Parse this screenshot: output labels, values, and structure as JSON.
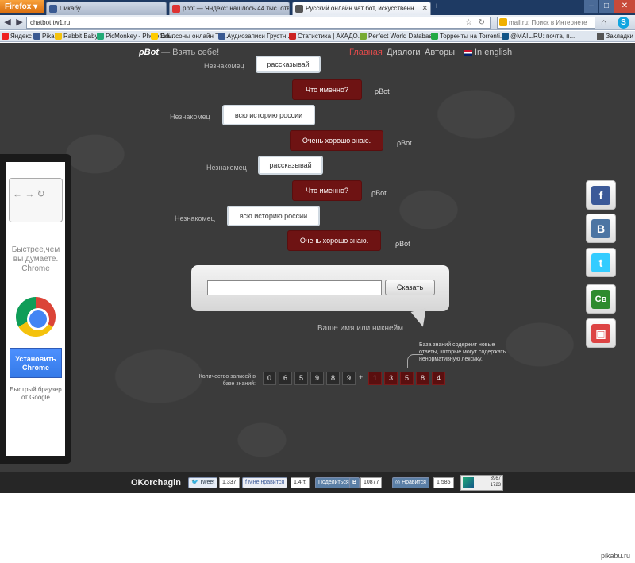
{
  "browser": {
    "menu_label": "Firefox",
    "tabs": [
      {
        "label": "Пикабу",
        "fav": "#3a5a92"
      },
      {
        "label": "pbot — Яндекс: нашлось 44 тыс. отве...",
        "fav": "#d33"
      },
      {
        "label": "Русский онлайн чат бот, искусственн...",
        "fav": "#555"
      }
    ],
    "url": "chatbot.tw1.ru",
    "search_placeholder": "mail.ru: Поиск в Интернете"
  },
  "bookmarks": [
    {
      "label": "Яндекс",
      "color": "#e22"
    },
    {
      "label": "Pikabu",
      "color": "#3a5a92"
    },
    {
      "label": "Rabbit Baby",
      "color": "#f4c20d"
    },
    {
      "label": "PicMonkey - Photo Edi...",
      "color": "#2a7"
    },
    {
      "label": "Симпсоны онлайн Th...",
      "color": "#fc0"
    },
    {
      "label": "Аудиозаписи Грустн...",
      "color": "#3a5a92"
    },
    {
      "label": "Статистика | АКАДО...",
      "color": "#c22"
    },
    {
      "label": "Perfect World Database",
      "color": "#7a3"
    },
    {
      "label": "Торренты на Torrenti...",
      "color": "#2a4"
    },
    {
      "label": "@MAIL.RU: почта, п...",
      "color": "#158"
    }
  ],
  "bookmarks_end": "Закладки",
  "site": {
    "logo_name": "ρBot",
    "logo_tagline": "— Взять себе!",
    "nav": [
      {
        "label": "Главная",
        "active": true
      },
      {
        "label": "Диалоги"
      },
      {
        "label": "Авторы"
      },
      {
        "label": "In english"
      }
    ]
  },
  "chat": [
    {
      "from": "user",
      "who": "Незнакомец",
      "text": "рассказывай"
    },
    {
      "from": "bot",
      "who": "ρBot",
      "text": "Что именно?"
    },
    {
      "from": "user",
      "who": "Незнакомец",
      "text": "всю историю россии"
    },
    {
      "from": "bot",
      "who": "ρBot",
      "text": "Очень хорошо знаю."
    },
    {
      "from": "user",
      "who": "Незнакомец",
      "text": "рассказывай"
    },
    {
      "from": "bot",
      "who": "ρBot",
      "text": "Что именно?"
    },
    {
      "from": "user",
      "who": "Незнакомец",
      "text": "всю историю россии"
    },
    {
      "from": "bot",
      "who": "ρBot",
      "text": "Очень хорошо знаю."
    }
  ],
  "input": {
    "value": "",
    "send_label": "Сказать",
    "nickname_hint": "Ваше имя или никнейм"
  },
  "knowledge": {
    "note": "База знаний содержит новые ответы, которые могут содержать ненормативную лексику.",
    "label": "Количество записей в базе знаний:",
    "digits": [
      "0",
      "6",
      "5",
      "9",
      "8",
      "9"
    ],
    "plus": "+",
    "new_digits": [
      "1",
      "3",
      "5",
      "8",
      "4"
    ]
  },
  "ad": {
    "headline": "Быстрее,чем вы думаете. Chrome",
    "button": "Установить Chrome",
    "foot_line1": "Быстрый браузер",
    "foot_line2": "от Google"
  },
  "social": [
    {
      "icon": "facebook-icon",
      "glyph": "f",
      "color": "#3b5998"
    },
    {
      "icon": "vkontakte-icon",
      "glyph": "B",
      "color": "#4c75a3"
    },
    {
      "icon": "twitter-icon",
      "glyph": "t",
      "color": "#33ccff"
    },
    {
      "icon": "cb-icon",
      "glyph": "Св",
      "color": "#2e8b2e"
    },
    {
      "icon": "chrome-store-icon",
      "glyph": "▣",
      "color": "#d44"
    }
  ],
  "footer": {
    "brand": "OKorchagin",
    "tweet_label": "Tweet",
    "tweet_count": "1,337",
    "fb_label": "Мне нравится",
    "fb_count": "1,4 т.",
    "vk_share": "Поделиться",
    "vk_count": "10877",
    "ok_label": "Нравится",
    "ok_count": "1 585",
    "stats_1": "3967",
    "stats_2": "1723"
  },
  "watermark": "pikabu.ru"
}
